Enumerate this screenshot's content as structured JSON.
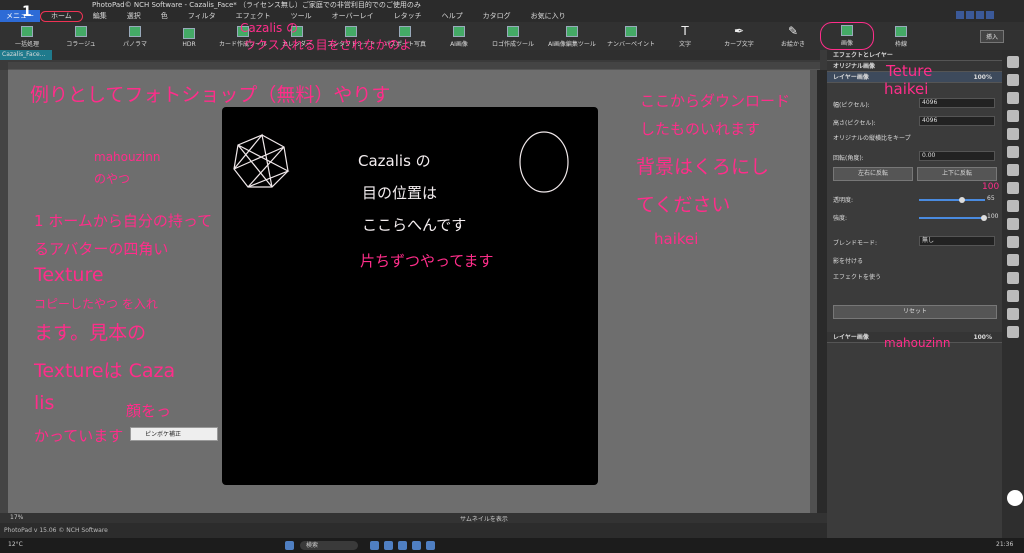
{
  "window": {
    "title": "PhotoPad© NCH Software - Cazalis_Face* （ライセンス無し）ご家庭での非営利目的でのご使用のみ",
    "search": "検索"
  },
  "menu": {
    "items": [
      "メニュー",
      "ホーム",
      "編集",
      "選択",
      "色",
      "フィルタ",
      "エフェクト",
      "ツール",
      "オーバーレイ",
      "レタッチ",
      "ヘルプ",
      "カタログ",
      "お気に入り"
    ]
  },
  "ribbon": {
    "buttons": [
      "一括処理",
      "コラージュ",
      "パノラマ",
      "HDR",
      "カード作成ツール",
      "カレンダー",
      "コンタクトシート",
      "パスポート写真",
      "AI画像",
      "ロゴ作成ツール",
      "AI画像編集ツール",
      "ナンバーペイント",
      "文字",
      "カーブ文字",
      "お絵かき",
      "画像",
      "枠線"
    ],
    "insert": "挿入"
  },
  "tabs": {
    "document": "Cazalis_Face..."
  },
  "status": {
    "zoom": "17%",
    "thumbnail": "サムネイルを表示",
    "app": "PhotoPad v 15.06 © NCH Software"
  },
  "pinboke": "ピンボケ補正",
  "panel": {
    "title": "エフェクトとレイヤー",
    "original_image": "オリジナル画像",
    "layer_image": "レイヤー画像",
    "layer_percent": "100%",
    "width_label": "幅(ピクセル):",
    "width_value": "4096",
    "height_label": "高さ(ピクセル):",
    "height_value": "4096",
    "keep_ratio": "オリジナルの縦横比をキープ",
    "rotation_label": "回転(角度):",
    "rotation_value": "0.00",
    "flip_h": "左右に反転",
    "flip_v": "上下に反転",
    "opacity_label": "透明度:",
    "opacity_value": "65",
    "strength_label": "強度:",
    "strength_value": "100",
    "blend_label": "ブレンドモード:",
    "blend_value": "無し",
    "shadow": "影を付ける",
    "use_effect": "エフェクトを使う",
    "reset": "リセット",
    "layer_image2": "レイヤー画像",
    "layer2_percent": "100%"
  },
  "taskbar": {
    "weather": "12°C",
    "search": "検索",
    "clock": "21:36"
  },
  "annotations": {
    "numeral": "1",
    "cazalis_top": "Cazalis の",
    "cazalis_top2": "ウクス入れる目をされなかのよ",
    "main_top": "例りとしてフォトショップ（無料）やりす",
    "mahouzinn": "mahouzinn",
    "noyatsu": "のやつ",
    "center1": "Cazalis の",
    "center2": "目の位置は",
    "center3": "ここらへんです",
    "center4": "片ちずつやってます",
    "right1": "ここからダウンロード",
    "right2": "したものいれます",
    "right3": "背景はくろにし",
    "right4": "てください",
    "right5": "haikei",
    "left1": "1 ホームから自分の持って",
    "left2": "るアバターの四角い",
    "left3": "Texture",
    "left4": "コピーしたやつ を入れ",
    "left5": "ます。見本の",
    "left6": "Textureは Caza",
    "left7": "lis",
    "left8": "顔をっ",
    "left9": "かっています",
    "tex_panel": "Teture",
    "haikei_panel": "haikei",
    "mahou_panel": "mahouzinn",
    "hundred": "100"
  }
}
